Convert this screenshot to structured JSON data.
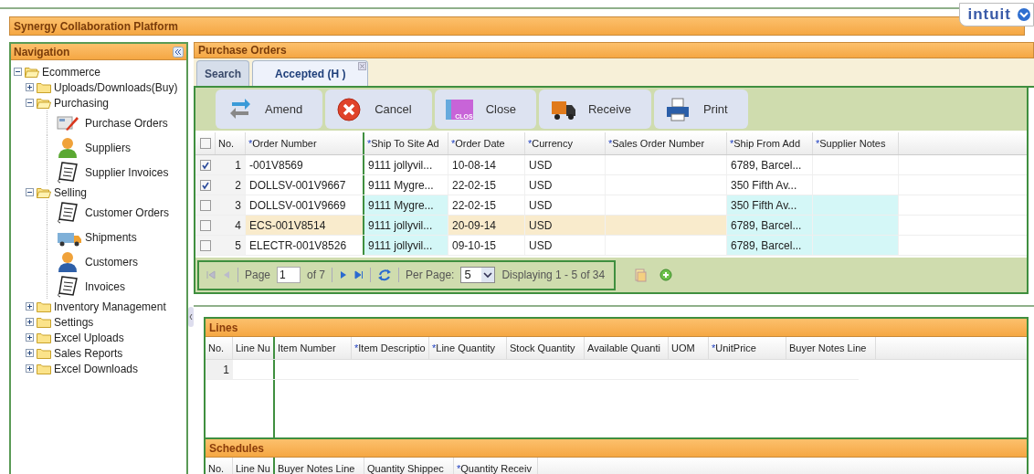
{
  "header": {
    "title": "Synergy Collaboration Platform",
    "brand": "intuit"
  },
  "navigation": {
    "title": "Navigation",
    "tree": [
      {
        "label": "Ecommerce",
        "kind": "folder",
        "expanded": true,
        "children": [
          {
            "label": "Uploads/Downloads(Buy)",
            "kind": "folder",
            "expanded": false
          },
          {
            "label": "Purchasing",
            "kind": "folder",
            "expanded": true,
            "children": [
              {
                "label": "Purchase Orders",
                "kind": "form"
              },
              {
                "label": "Suppliers",
                "kind": "supplier"
              },
              {
                "label": "Supplier Invoices",
                "kind": "document"
              }
            ]
          },
          {
            "label": "Selling",
            "kind": "folder",
            "expanded": true,
            "children": [
              {
                "label": "Customer Orders",
                "kind": "document"
              },
              {
                "label": "Shipments",
                "kind": "shipment"
              },
              {
                "label": "Customers",
                "kind": "customer"
              },
              {
                "label": "Invoices",
                "kind": "document"
              }
            ]
          },
          {
            "label": "Inventory Management",
            "kind": "folder",
            "expanded": false
          },
          {
            "label": "Settings",
            "kind": "folder",
            "expanded": false
          },
          {
            "label": "Excel Uploads",
            "kind": "folder",
            "expanded": false
          },
          {
            "label": "Sales Reports",
            "kind": "folder",
            "expanded": false
          },
          {
            "label": "Excel Downloads",
            "kind": "folder",
            "expanded": false
          }
        ]
      }
    ]
  },
  "main": {
    "title": "Purchase Orders",
    "tabs": [
      {
        "label": "Search",
        "selected": false,
        "closable": false
      },
      {
        "label": "Accepted (H )",
        "selected": true,
        "closable": true
      }
    ],
    "toolbar": [
      {
        "label": "Amend",
        "kind": "amend"
      },
      {
        "label": "Cancel",
        "kind": "cancel"
      },
      {
        "label": "Close",
        "kind": "close",
        "icon_text": "CLOS"
      },
      {
        "label": "Receive",
        "kind": "receive"
      },
      {
        "label": "Print",
        "kind": "print"
      }
    ],
    "orders": {
      "all_checked": false,
      "columns": [
        {
          "label": "No."
        },
        {
          "label": "Order Number",
          "mark": "*"
        },
        {
          "label": "Ship To Site Ad",
          "mark": "*"
        },
        {
          "label": "Order Date",
          "mark": "*"
        },
        {
          "label": "Currency",
          "mark": "*"
        },
        {
          "label": "Sales Order Number",
          "mark": "*"
        },
        {
          "label": "Ship From Add",
          "mark": "*"
        },
        {
          "label": "Supplier Notes",
          "mark": "*"
        }
      ],
      "rows": [
        {
          "checked": true,
          "highlighted": false,
          "changed": false,
          "no": "1",
          "order_number": "-001V8569",
          "ship_to": "9111 jollyvil...",
          "order_date": "10-08-14",
          "currency": "USD",
          "ship_from": "6789, Barcel..."
        },
        {
          "checked": true,
          "highlighted": false,
          "changed": false,
          "no": "2",
          "order_number": "DOLLSV-001V9667",
          "ship_to": "9111 Mygre...",
          "order_date": "22-02-15",
          "currency": "USD",
          "ship_from": "350 Fifth Av..."
        },
        {
          "checked": false,
          "highlighted": false,
          "changed": true,
          "no": "3",
          "order_number": "DOLLSV-001V9669",
          "ship_to": "9111 Mygre...",
          "order_date": "22-02-15",
          "currency": "USD",
          "ship_from": "350 Fifth Av..."
        },
        {
          "checked": false,
          "highlighted": true,
          "changed": true,
          "no": "4",
          "order_number": "ECS-001V8514",
          "ship_to": "9111 jollyvil...",
          "order_date": "20-09-14",
          "currency": "USD",
          "ship_from": "6789, Barcel..."
        },
        {
          "checked": false,
          "highlighted": false,
          "changed": true,
          "no": "5",
          "order_number": "ELECTR-001V8526",
          "ship_to": "9111 jollyvil...",
          "order_date": "09-10-15",
          "currency": "USD",
          "ship_from": "6789, Barcel..."
        }
      ]
    },
    "pager": {
      "page_label": "Page",
      "page": "1",
      "of": "of 7",
      "per_page_label": "Per Page:",
      "per_page": "5",
      "display": "Displaying 1 - 5 of 34"
    },
    "lines": {
      "title": "Lines",
      "columns": [
        {
          "label": "No."
        },
        {
          "label": "Line Nu"
        },
        {
          "label": "Item Number"
        },
        {
          "label": "Item Descriptio",
          "mark": "*"
        },
        {
          "label": "Line Quantity",
          "mark": "*"
        },
        {
          "label": "Stock Quantity"
        },
        {
          "label": "Available Quanti"
        },
        {
          "label": "UOM"
        },
        {
          "label": "UnitPrice",
          "mark": "*"
        },
        {
          "label": "Buyer Notes Line"
        }
      ],
      "rows": [
        {
          "no": "1"
        }
      ]
    },
    "schedules": {
      "title": "Schedules",
      "columns": [
        {
          "label": "No."
        },
        {
          "label": "Line Nu"
        },
        {
          "label": "Buyer Notes Line"
        },
        {
          "label": "Quantity Shippec"
        },
        {
          "label": "Quantity Receiv",
          "mark": "*"
        }
      ]
    }
  }
}
